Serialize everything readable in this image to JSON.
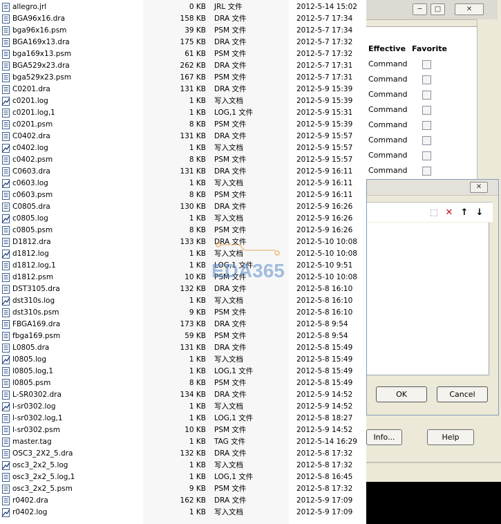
{
  "files": [
    {
      "name": "allegro.jrl",
      "size": "0 KB",
      "type": "JRL 文件",
      "date": "2012-5-14 15:02",
      "icon": "doc-icon"
    },
    {
      "name": "BGA96x16.dra",
      "size": "158 KB",
      "type": "DRA 文件",
      "date": "2012-5-7 17:34",
      "icon": "doc-icon"
    },
    {
      "name": "bga96x16.psm",
      "size": "39 KB",
      "type": "PSM 文件",
      "date": "2012-5-7 17:34",
      "icon": "doc-icon"
    },
    {
      "name": "BGA169x13.dra",
      "size": "175 KB",
      "type": "DRA 文件",
      "date": "2012-5-7 17:32",
      "icon": "doc-icon"
    },
    {
      "name": "bga169x13.psm",
      "size": "61 KB",
      "type": "PSM 文件",
      "date": "2012-5-7 17:32",
      "icon": "doc-icon"
    },
    {
      "name": "BGA529x23.dra",
      "size": "262 KB",
      "type": "DRA 文件",
      "date": "2012-5-7 17:31",
      "icon": "doc-icon"
    },
    {
      "name": "bga529x23.psm",
      "size": "167 KB",
      "type": "PSM 文件",
      "date": "2012-5-7 17:31",
      "icon": "doc-icon"
    },
    {
      "name": "C0201.dra",
      "size": "131 KB",
      "type": "DRA 文件",
      "date": "2012-5-9 15:39",
      "icon": "doc-icon"
    },
    {
      "name": "c0201.log",
      "size": "1 KB",
      "type": "写入文档",
      "date": "2012-5-9 15:39",
      "icon": "log-icon"
    },
    {
      "name": "c0201.log,1",
      "size": "1 KB",
      "type": "LOG,1 文件",
      "date": "2012-5-9 15:31",
      "icon": "doc-icon"
    },
    {
      "name": "c0201.psm",
      "size": "8 KB",
      "type": "PSM 文件",
      "date": "2012-5-9 15:39",
      "icon": "doc-icon"
    },
    {
      "name": "C0402.dra",
      "size": "131 KB",
      "type": "DRA 文件",
      "date": "2012-5-9 15:57",
      "icon": "doc-icon"
    },
    {
      "name": "c0402.log",
      "size": "1 KB",
      "type": "写入文档",
      "date": "2012-5-9 15:57",
      "icon": "log-icon"
    },
    {
      "name": "c0402.psm",
      "size": "8 KB",
      "type": "PSM 文件",
      "date": "2012-5-9 15:57",
      "icon": "doc-icon"
    },
    {
      "name": "C0603.dra",
      "size": "131 KB",
      "type": "DRA 文件",
      "date": "2012-5-9 16:11",
      "icon": "doc-icon"
    },
    {
      "name": "c0603.log",
      "size": "1 KB",
      "type": "写入文档",
      "date": "2012-5-9 16:11",
      "icon": "log-icon"
    },
    {
      "name": "c0603.psm",
      "size": "8 KB",
      "type": "PSM 文件",
      "date": "2012-5-9 16:11",
      "icon": "doc-icon"
    },
    {
      "name": "C0805.dra",
      "size": "130 KB",
      "type": "DRA 文件",
      "date": "2012-5-9 16:26",
      "icon": "doc-icon"
    },
    {
      "name": "c0805.log",
      "size": "1 KB",
      "type": "写入文档",
      "date": "2012-5-9 16:26",
      "icon": "log-icon"
    },
    {
      "name": "c0805.psm",
      "size": "8 KB",
      "type": "PSM 文件",
      "date": "2012-5-9 16:26",
      "icon": "doc-icon"
    },
    {
      "name": "D1812.dra",
      "size": "133 KB",
      "type": "DRA 文件",
      "date": "2012-5-10 10:08",
      "icon": "doc-icon"
    },
    {
      "name": "d1812.log",
      "size": "1 KB",
      "type": "写入文档",
      "date": "2012-5-10 10:08",
      "icon": "log-icon"
    },
    {
      "name": "d1812.log,1",
      "size": "1 KB",
      "type": "LOG,1 文件",
      "date": "2012-5-10 9:51",
      "icon": "doc-icon"
    },
    {
      "name": "d1812.psm",
      "size": "10 KB",
      "type": "PSM 文件",
      "date": "2012-5-10 10:08",
      "icon": "doc-icon"
    },
    {
      "name": "DST3105.dra",
      "size": "132 KB",
      "type": "DRA 文件",
      "date": "2012-5-8 16:10",
      "icon": "doc-icon"
    },
    {
      "name": "dst310s.log",
      "size": "1 KB",
      "type": "写入文档",
      "date": "2012-5-8 16:10",
      "icon": "log-icon"
    },
    {
      "name": "dst310s.psm",
      "size": "9 KB",
      "type": "PSM 文件",
      "date": "2012-5-8 16:10",
      "icon": "doc-icon"
    },
    {
      "name": "FBGA169.dra",
      "size": "173 KB",
      "type": "DRA 文件",
      "date": "2012-5-8 9:54",
      "icon": "doc-icon"
    },
    {
      "name": "fbga169.psm",
      "size": "59 KB",
      "type": "PSM 文件",
      "date": "2012-5-8 9:54",
      "icon": "doc-icon"
    },
    {
      "name": "L0805.dra",
      "size": "131 KB",
      "type": "DRA 文件",
      "date": "2012-5-8 15:49",
      "icon": "doc-icon"
    },
    {
      "name": "l0805.log",
      "size": "1 KB",
      "type": "写入文档",
      "date": "2012-5-8 15:49",
      "icon": "log-icon"
    },
    {
      "name": "l0805.log,1",
      "size": "1 KB",
      "type": "LOG,1 文件",
      "date": "2012-5-8 15:49",
      "icon": "doc-icon"
    },
    {
      "name": "l0805.psm",
      "size": "8 KB",
      "type": "PSM 文件",
      "date": "2012-5-8 15:49",
      "icon": "doc-icon"
    },
    {
      "name": "L-SR0302.dra",
      "size": "134 KB",
      "type": "DRA 文件",
      "date": "2012-5-9 14:52",
      "icon": "doc-icon"
    },
    {
      "name": "l-sr0302.log",
      "size": "1 KB",
      "type": "写入文档",
      "date": "2012-5-9 14:52",
      "icon": "log-icon"
    },
    {
      "name": "l-sr0302.log,1",
      "size": "1 KB",
      "type": "LOG,1 文件",
      "date": "2012-5-8 18:27",
      "icon": "doc-icon"
    },
    {
      "name": "l-sr0302.psm",
      "size": "10 KB",
      "type": "PSM 文件",
      "date": "2012-5-9 14:52",
      "icon": "doc-icon"
    },
    {
      "name": "master.tag",
      "size": "1 KB",
      "type": "TAG 文件",
      "date": "2012-5-14 16:29",
      "icon": "doc-icon"
    },
    {
      "name": "OSC3_2X2_5.dra",
      "size": "132 KB",
      "type": "DRA 文件",
      "date": "2012-5-8 17:32",
      "icon": "doc-icon"
    },
    {
      "name": "osc3_2x2_5.log",
      "size": "1 KB",
      "type": "写入文档",
      "date": "2012-5-8 17:32",
      "icon": "log-icon"
    },
    {
      "name": "osc3_2x2_5.log,1",
      "size": "1 KB",
      "type": "LOG,1 文件",
      "date": "2012-5-8 16:45",
      "icon": "doc-icon"
    },
    {
      "name": "osc3_2x2_5.psm",
      "size": "9 KB",
      "type": "PSM 文件",
      "date": "2012-5-8 17:32",
      "icon": "doc-icon"
    },
    {
      "name": "r0402.dra",
      "size": "162 KB",
      "type": "DRA 文件",
      "date": "2012-5-9 17:09",
      "icon": "doc-icon"
    },
    {
      "name": "r0402.log",
      "size": "1 KB",
      "type": "写入文档",
      "date": "2012-5-9 17:09",
      "icon": "log-icon"
    }
  ],
  "dialog_back": {
    "minimize": "─",
    "maximize": "□",
    "close": "✕",
    "col_effective": "Effective",
    "col_favorite": "Favorite",
    "rows": [
      "Command",
      "Command",
      "Command",
      "Command",
      "Command",
      "Command",
      "Command",
      "Command"
    ],
    "info_button": "Info...",
    "help_button": "Help"
  },
  "dialog_front": {
    "close": "✕",
    "ok_button": "OK",
    "cancel_button": "Cancel",
    "tools": {
      "new": "⬚",
      "delete": "✕",
      "up": "↑",
      "down": "↓"
    },
    "delete_color": "#c0141b"
  },
  "watermark": {
    "text": "EDA365"
  }
}
